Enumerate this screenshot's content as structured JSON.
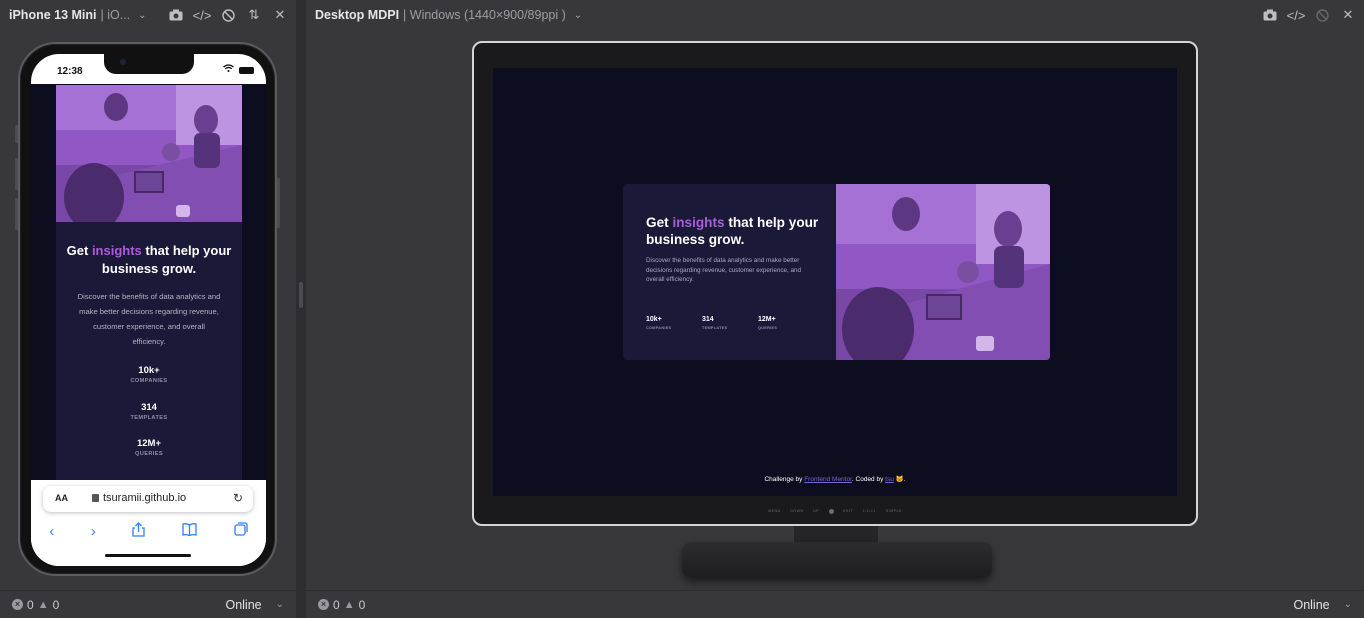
{
  "left_panel": {
    "device_name": "iPhone 13 Mini",
    "device_os": "| iO...",
    "status": {
      "errors": "0",
      "warnings": "0",
      "network": "Online"
    }
  },
  "right_panel": {
    "device_name": "Desktop MDPI",
    "device_spec": "| Windows (1440×900/89ppi )",
    "status": {
      "errors": "0",
      "warnings": "0",
      "network": "Online"
    }
  },
  "phone": {
    "time": "12:38",
    "url": "tsuramii.github.io",
    "aa_label": "AA"
  },
  "site": {
    "heading_pre": "Get ",
    "heading_accent": "insights",
    "heading_post": " that help your business grow.",
    "description": "Discover the benefits of data analytics and make better decisions regarding revenue, customer experience, and overall efficiency.",
    "stats": [
      {
        "value": "10k+",
        "label": "COMPANIES"
      },
      {
        "value": "314",
        "label": "TEMPLATES"
      },
      {
        "value": "12M+",
        "label": "QUERIES"
      }
    ],
    "attribution": {
      "prefix": "Challenge by ",
      "link1": "Frontend Mentor",
      "middle": ". Coded by ",
      "link2": "tsu",
      "suffix": " 🐱."
    }
  },
  "monitor_osd": [
    "MENU",
    "DOWN",
    "UP",
    "EXIT",
    "1:1/ℒ1",
    "SIMPLE"
  ],
  "colors": {
    "accent": "#ab5cdb",
    "page_bg": "#0c0e1f",
    "card_bg": "#1b1938",
    "overlay": "#9d61c9"
  }
}
